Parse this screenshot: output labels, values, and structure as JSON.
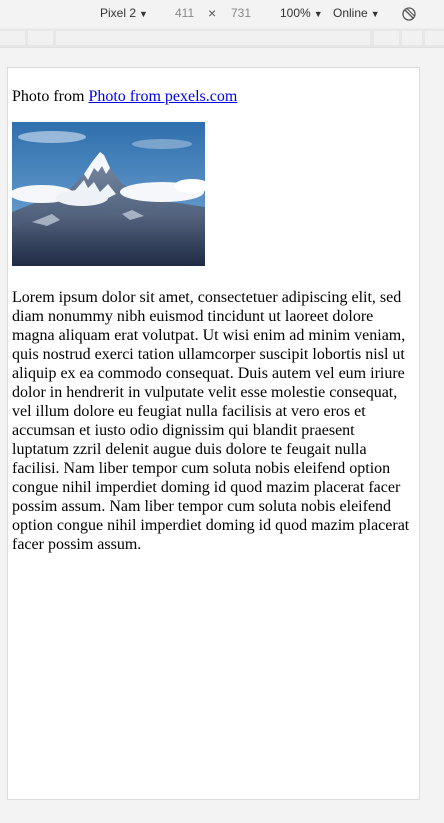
{
  "devtools": {
    "device": "Pixel 2",
    "width": "411",
    "times": "×",
    "height": "731",
    "zoom": "100%",
    "throttle": "Online",
    "caret": "▼",
    "rotate_icon": "rotate-icon"
  },
  "page": {
    "credit_prefix": "Photo from ",
    "credit_link": "Photo from pexels.com",
    "photo_icon": "mountain-photo",
    "body_text": "Lorem ipsum dolor sit amet, consectetuer adipiscing elit, sed diam nonummy nibh euismod tincidunt ut laoreet dolore magna aliquam erat volutpat. Ut wisi enim ad minim veniam, quis nostrud exerci tation ullamcorper suscipit lobortis nisl ut aliquip ex ea commodo consequat. Duis autem vel eum iriure dolor in hendrerit in vulputate velit esse molestie consequat, vel illum dolore eu feugiat nulla facilisis at vero eros et accumsan et iusto odio dignissim qui blandit praesent luptatum zzril delenit augue duis dolore te feugait nulla facilisi. Nam liber tempor cum soluta nobis eleifend option congue nihil imperdiet doming id quod mazim placerat facer possim assum. Nam liber tempor cum soluta nobis eleifend option congue nihil imperdiet doming id quod mazim placerat facer possim assum."
  },
  "colors": {
    "link": "#0000ee",
    "toolbar_bg": "#f3f3f3"
  }
}
